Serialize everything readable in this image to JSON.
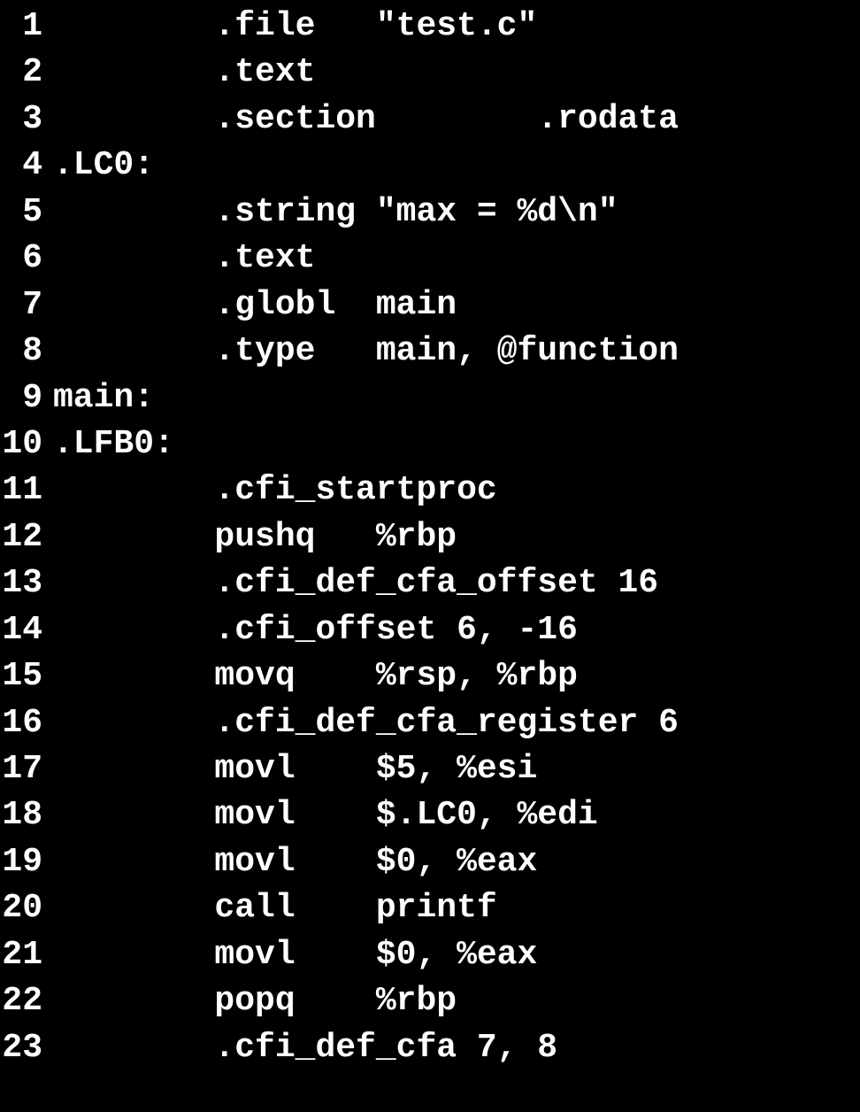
{
  "code": {
    "lines": [
      {
        "num": "1",
        "text": "        .file   \"test.c\""
      },
      {
        "num": "2",
        "text": "        .text"
      },
      {
        "num": "3",
        "text": "        .section        .rodata"
      },
      {
        "num": "4",
        "text": ".LC0:"
      },
      {
        "num": "5",
        "text": "        .string \"max = %d\\n\""
      },
      {
        "num": "6",
        "text": "        .text"
      },
      {
        "num": "7",
        "text": "        .globl  main"
      },
      {
        "num": "8",
        "text": "        .type   main, @function"
      },
      {
        "num": "9",
        "text": "main:"
      },
      {
        "num": "10",
        "text": ".LFB0:"
      },
      {
        "num": "11",
        "text": "        .cfi_startproc"
      },
      {
        "num": "12",
        "text": "        pushq   %rbp"
      },
      {
        "num": "13",
        "text": "        .cfi_def_cfa_offset 16"
      },
      {
        "num": "14",
        "text": "        .cfi_offset 6, -16"
      },
      {
        "num": "15",
        "text": "        movq    %rsp, %rbp"
      },
      {
        "num": "16",
        "text": "        .cfi_def_cfa_register 6"
      },
      {
        "num": "17",
        "text": "        movl    $5, %esi"
      },
      {
        "num": "18",
        "text": "        movl    $.LC0, %edi"
      },
      {
        "num": "19",
        "text": "        movl    $0, %eax"
      },
      {
        "num": "20",
        "text": "        call    printf"
      },
      {
        "num": "21",
        "text": "        movl    $0, %eax"
      },
      {
        "num": "22",
        "text": "        popq    %rbp"
      },
      {
        "num": "23",
        "text": "        .cfi_def_cfa 7, 8"
      }
    ]
  }
}
